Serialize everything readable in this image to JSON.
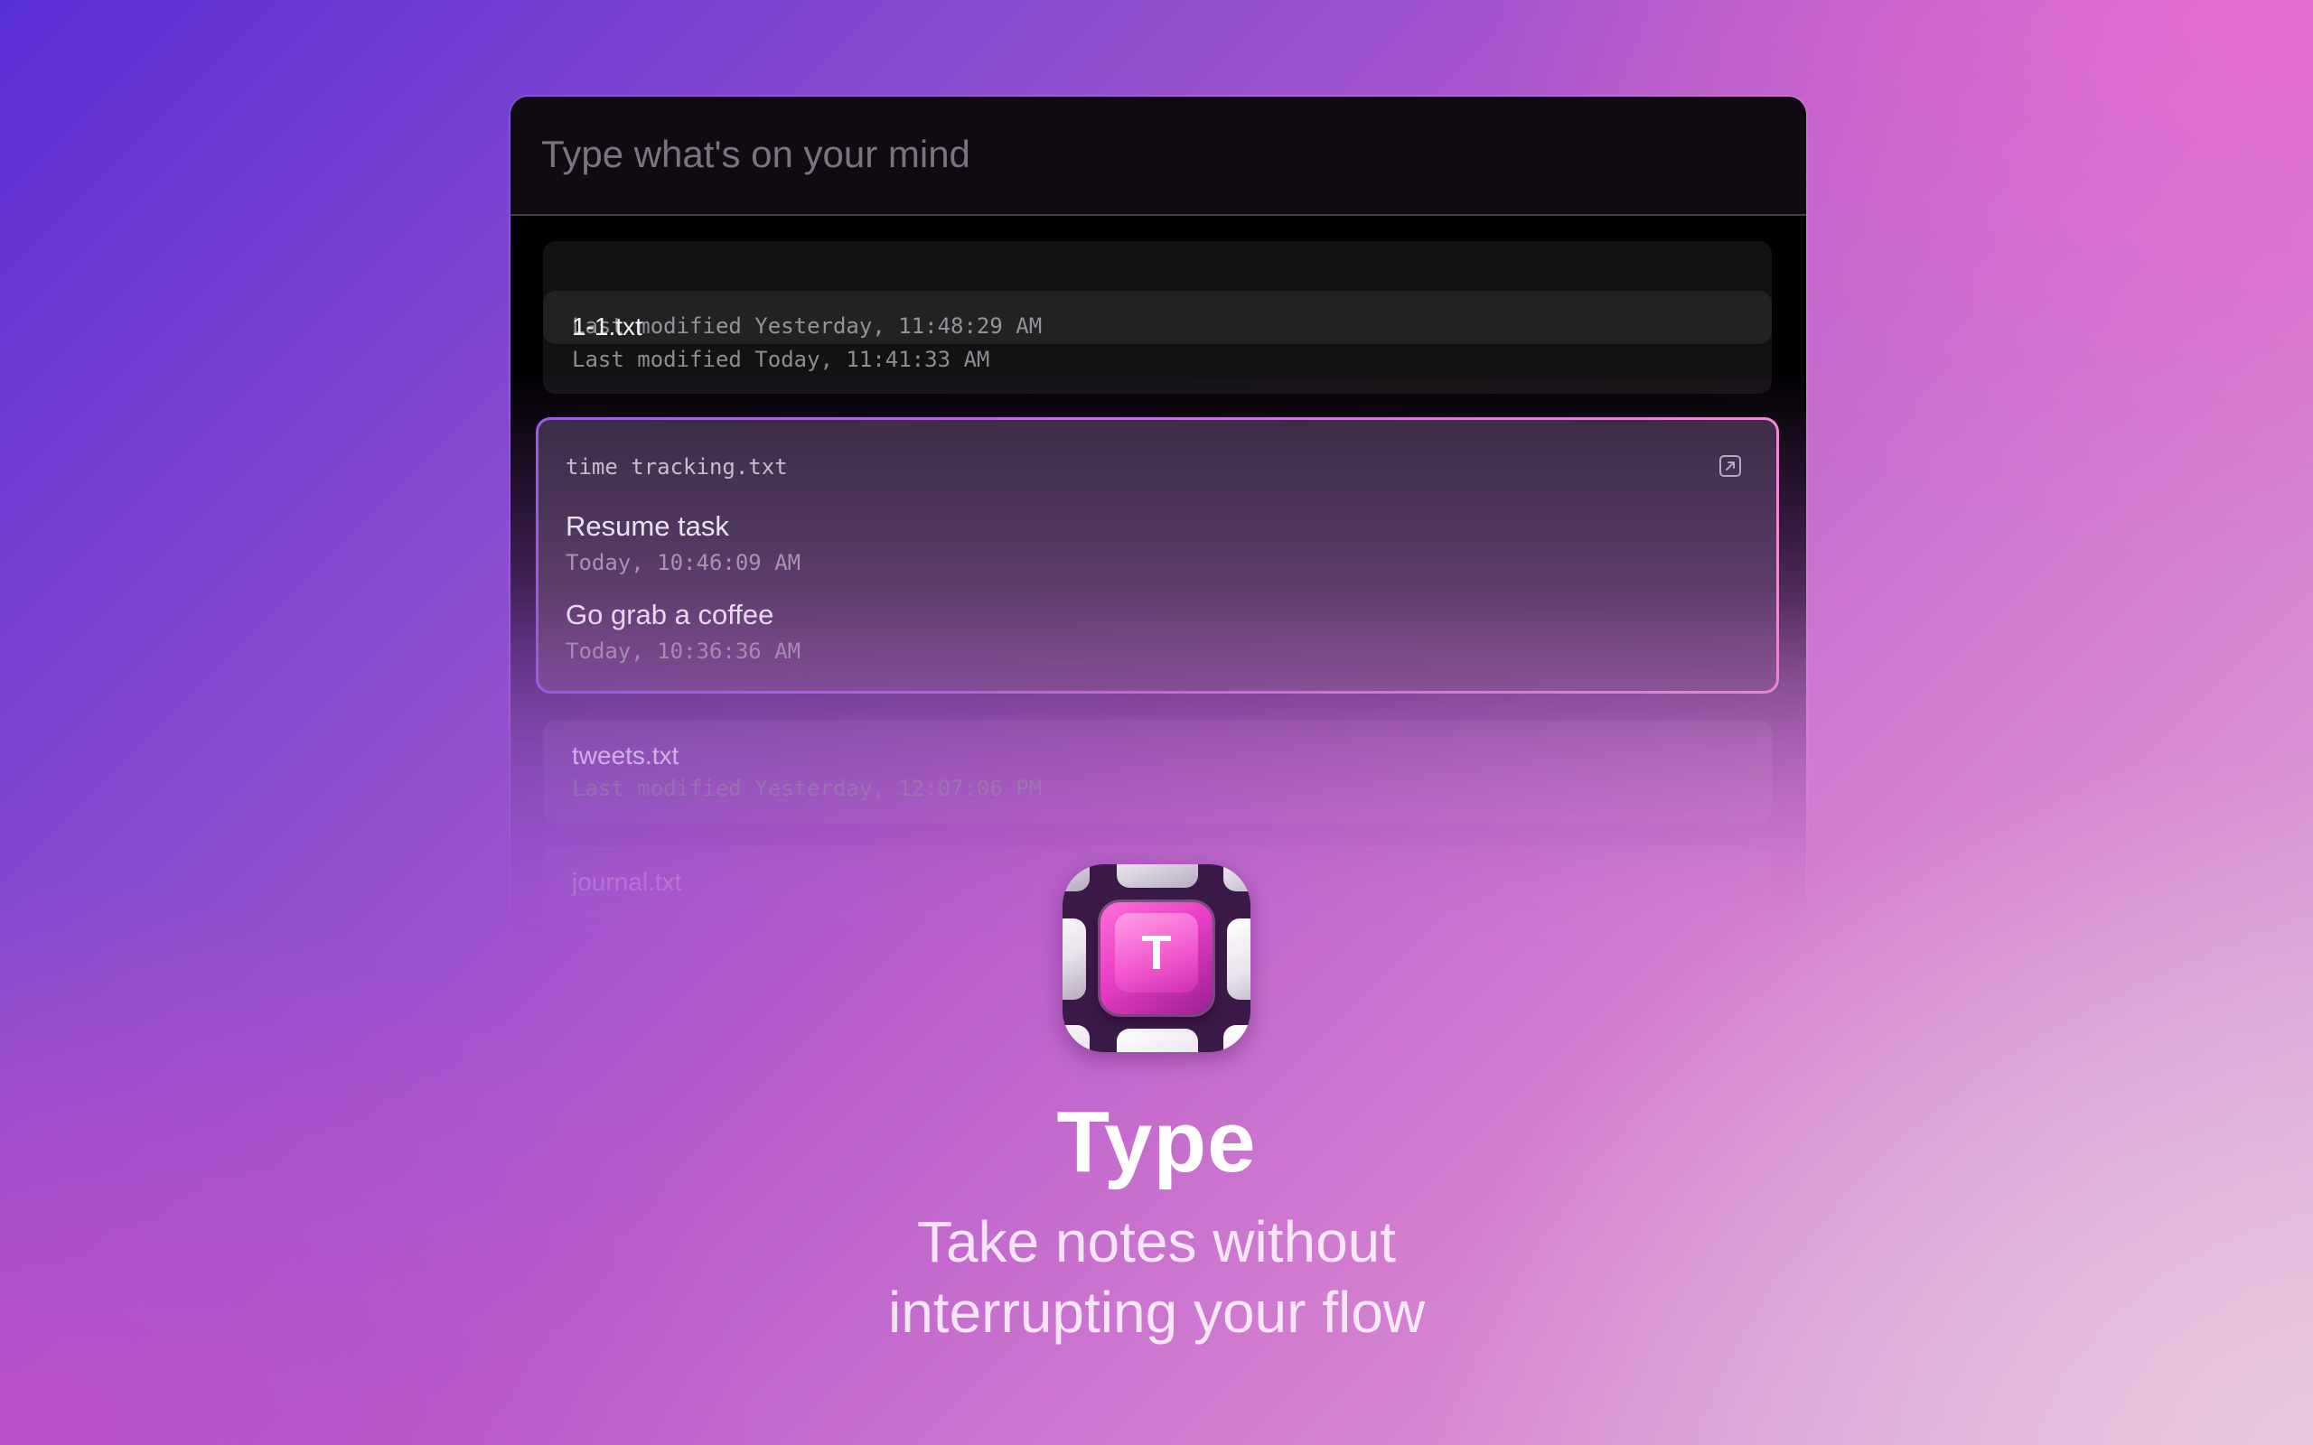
{
  "search": {
    "placeholder": "Type what's on your mind"
  },
  "files": [
    {
      "name": "",
      "meta": "Last modified Yesterday, 11:48:29 AM"
    },
    {
      "name": "1-1.txt",
      "meta": "Last modified Today, 11:41:33 AM"
    },
    {
      "name": "tweets.txt",
      "meta": "Last modified Yesterday, 12:07:06 PM"
    },
    {
      "name": "journal.txt",
      "meta": ""
    }
  ],
  "selected_file": {
    "name": "time tracking.txt",
    "open_icon": "open-external-icon",
    "entries": [
      {
        "text": "Resume task",
        "time": "Today, 10:46:09 AM"
      },
      {
        "text": "Go grab a coffee",
        "time": "Today, 10:36:36 AM"
      }
    ]
  },
  "app": {
    "icon_letter": "T",
    "name": "Type",
    "tagline_line1": "Take notes without",
    "tagline_line2": "interrupting your flow"
  },
  "colors": {
    "accent_gradient_start": "#9b5be8",
    "accent_gradient_end": "#f28ad6",
    "icon_key_pink": "#e93ec5"
  }
}
